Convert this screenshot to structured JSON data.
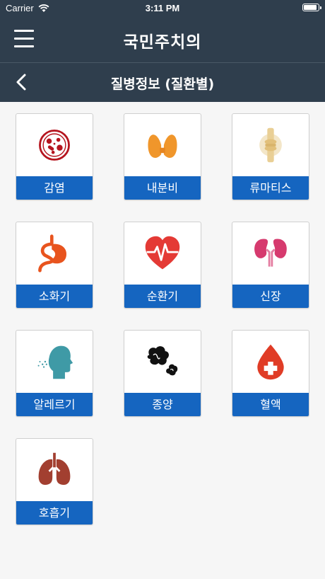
{
  "status_bar": {
    "carrier": "Carrier",
    "time": "3:11 PM"
  },
  "header": {
    "title": "국민주치의"
  },
  "sub_header": {
    "title": "질병정보 (질환별)"
  },
  "categories": [
    {
      "label": "감염",
      "icon": "bacteria-icon"
    },
    {
      "label": "내분비",
      "icon": "thyroid-icon"
    },
    {
      "label": "류마티스",
      "icon": "joint-icon"
    },
    {
      "label": "소화기",
      "icon": "stomach-icon"
    },
    {
      "label": "순환기",
      "icon": "heart-icon"
    },
    {
      "label": "신장",
      "icon": "kidney-icon"
    },
    {
      "label": "알레르기",
      "icon": "sneeze-icon"
    },
    {
      "label": "종양",
      "icon": "tumor-icon"
    },
    {
      "label": "혈액",
      "icon": "blood-drop-icon"
    },
    {
      "label": "호흡기",
      "icon": "lungs-icon"
    }
  ],
  "colors": {
    "header_bg": "#2f3e4d",
    "label_bg": "#1565c0",
    "page_bg": "#f6f6f6"
  }
}
